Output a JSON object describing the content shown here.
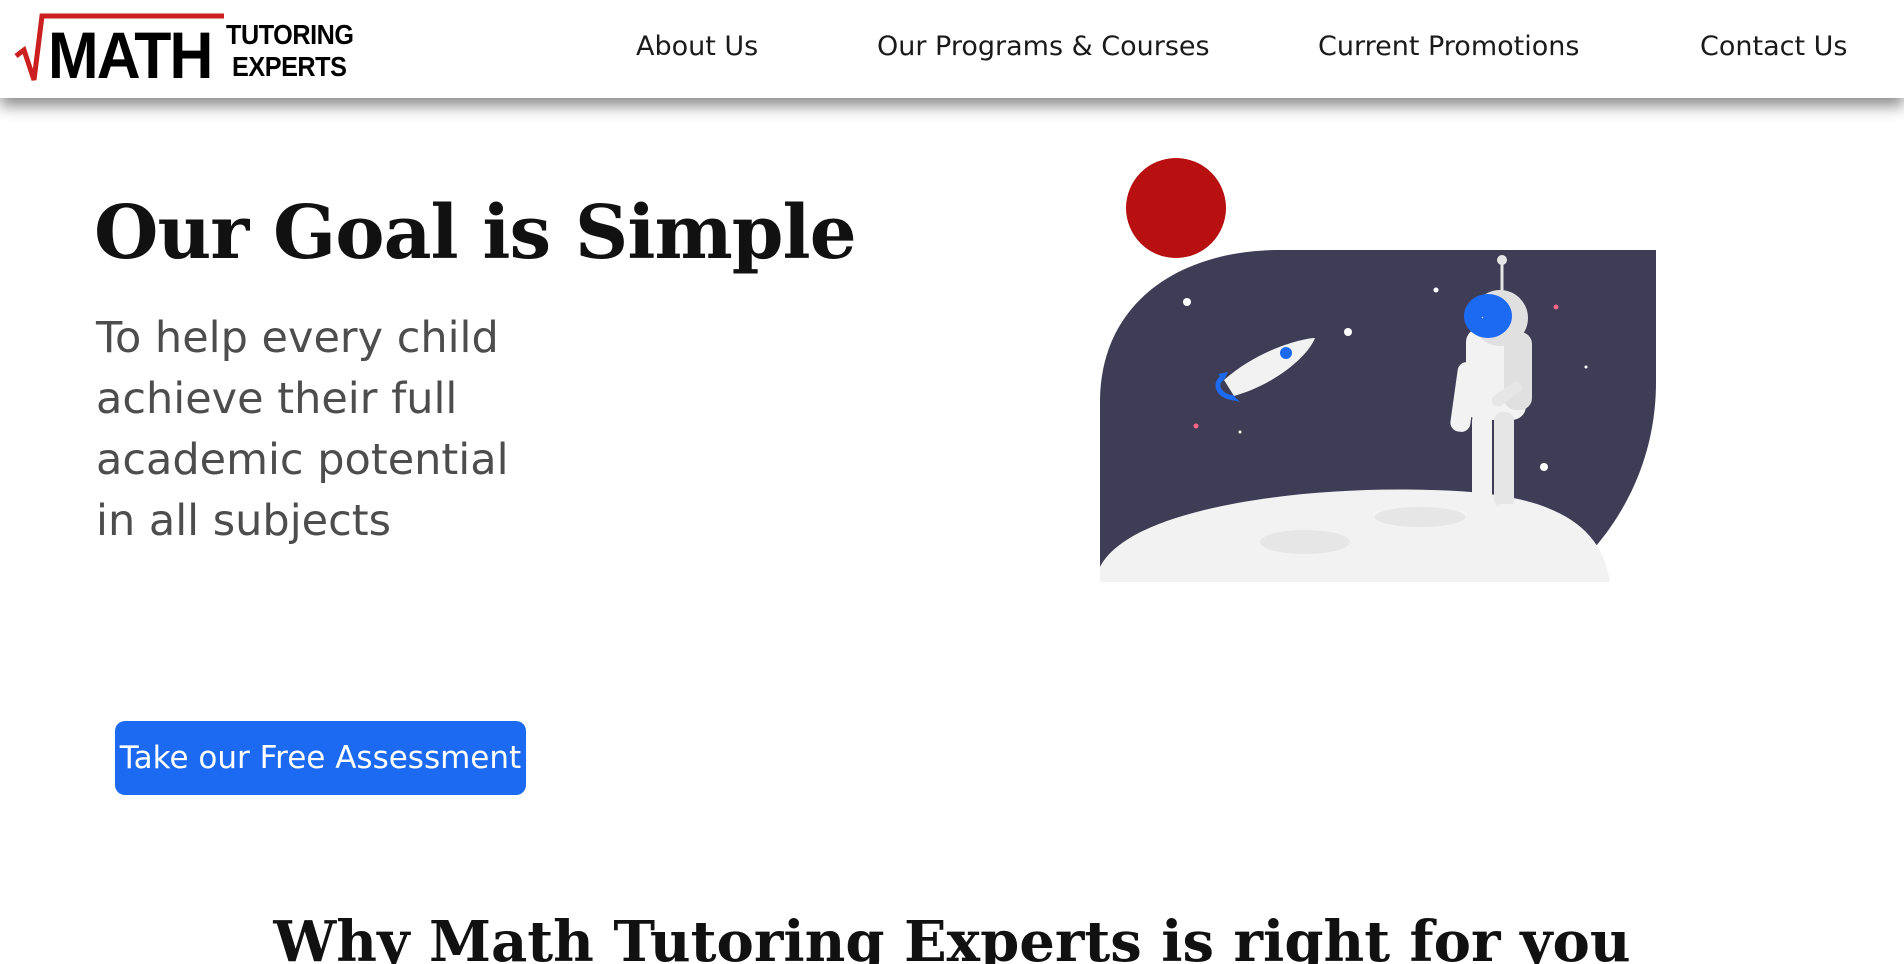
{
  "header": {
    "logo": {
      "math_text": "MATH",
      "line1": "TUTORING",
      "line2": "EXPERTS",
      "accent_color": "#cc1f1f"
    },
    "nav": [
      {
        "label": "About Us"
      },
      {
        "label": "Our Programs & Courses"
      },
      {
        "label": "Current Promotions"
      },
      {
        "label": "Contact Us"
      }
    ]
  },
  "hero": {
    "title": "Our Goal is Simple",
    "subtitle_lines": [
      "To help every child",
      "achieve their full",
      "academic potential",
      "in all subjects"
    ],
    "illustration": {
      "icon": "astronaut-on-moon-illustration",
      "colors": {
        "sky": "#3f3d56",
        "sun": "#b81010",
        "moon": "#f2f2f2",
        "helmet": "#1d6af2"
      }
    },
    "cta_label": "Take our Free Assessment",
    "cta_color": "#1d6af2"
  },
  "section": {
    "title": "Why Math Tutoring Experts is right for you"
  }
}
